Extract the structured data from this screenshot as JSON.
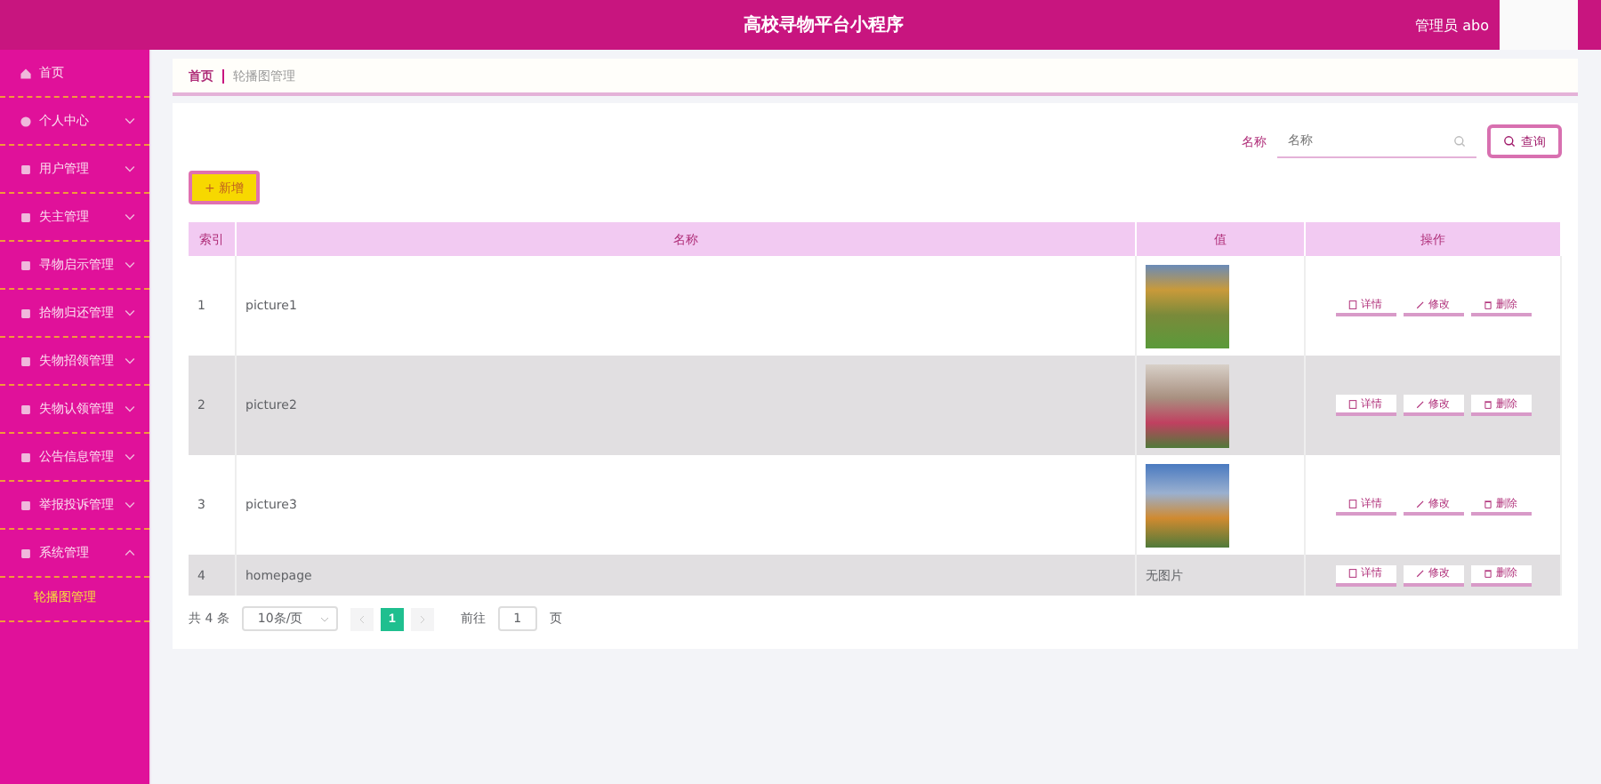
{
  "header": {
    "title": "高校寻物平台小程序",
    "user": "管理员 abo"
  },
  "sidebar": {
    "items": [
      {
        "label": "首页",
        "expandable": false
      },
      {
        "label": "个人中心",
        "expandable": true,
        "expanded": false
      },
      {
        "label": "用户管理",
        "expandable": true,
        "expanded": false
      },
      {
        "label": "失主管理",
        "expandable": true,
        "expanded": false
      },
      {
        "label": "寻物启示管理",
        "expandable": true,
        "expanded": false
      },
      {
        "label": "拾物归还管理",
        "expandable": true,
        "expanded": false
      },
      {
        "label": "失物招领管理",
        "expandable": true,
        "expanded": false
      },
      {
        "label": "失物认领管理",
        "expandable": true,
        "expanded": false
      },
      {
        "label": "公告信息管理",
        "expandable": true,
        "expanded": false
      },
      {
        "label": "举报投诉管理",
        "expandable": true,
        "expanded": false
      },
      {
        "label": "系统管理",
        "expandable": true,
        "expanded": true,
        "children": [
          {
            "label": "轮播图管理",
            "selected": true
          }
        ]
      }
    ]
  },
  "breadcrumb": [
    "首页",
    "轮播图管理"
  ],
  "search": {
    "label": "名称",
    "placeholder": "名称",
    "button": "查询"
  },
  "add_button": "+ 新增",
  "table": {
    "columns": [
      "索引",
      "名称",
      "值",
      "操作"
    ],
    "rows": [
      {
        "index": "1",
        "name": "picture1",
        "kind": "photo",
        "highlighted": false,
        "actions": [
          "详情",
          "修改",
          "删除"
        ]
      },
      {
        "index": "2",
        "name": "picture2",
        "kind": "photo",
        "highlighted": true,
        "actions": [
          "详情",
          "修改",
          "删除"
        ]
      },
      {
        "index": "3",
        "name": "picture3",
        "kind": "photo",
        "highlighted": false,
        "actions": [
          "详情",
          "修改",
          "删除"
        ]
      },
      {
        "index": "4",
        "name": "homepage",
        "kind": "text",
        "value": "无图片",
        "highlighted": true,
        "actions": [
          "详情",
          "修改",
          "删除"
        ]
      }
    ]
  },
  "pagination": {
    "total": "共 4 条",
    "page_size": "10条/页",
    "pages": [
      {
        "label": "1",
        "selected": true
      }
    ],
    "goto_label": "前往",
    "goto_value": "1",
    "goto_suffix": "页"
  }
}
